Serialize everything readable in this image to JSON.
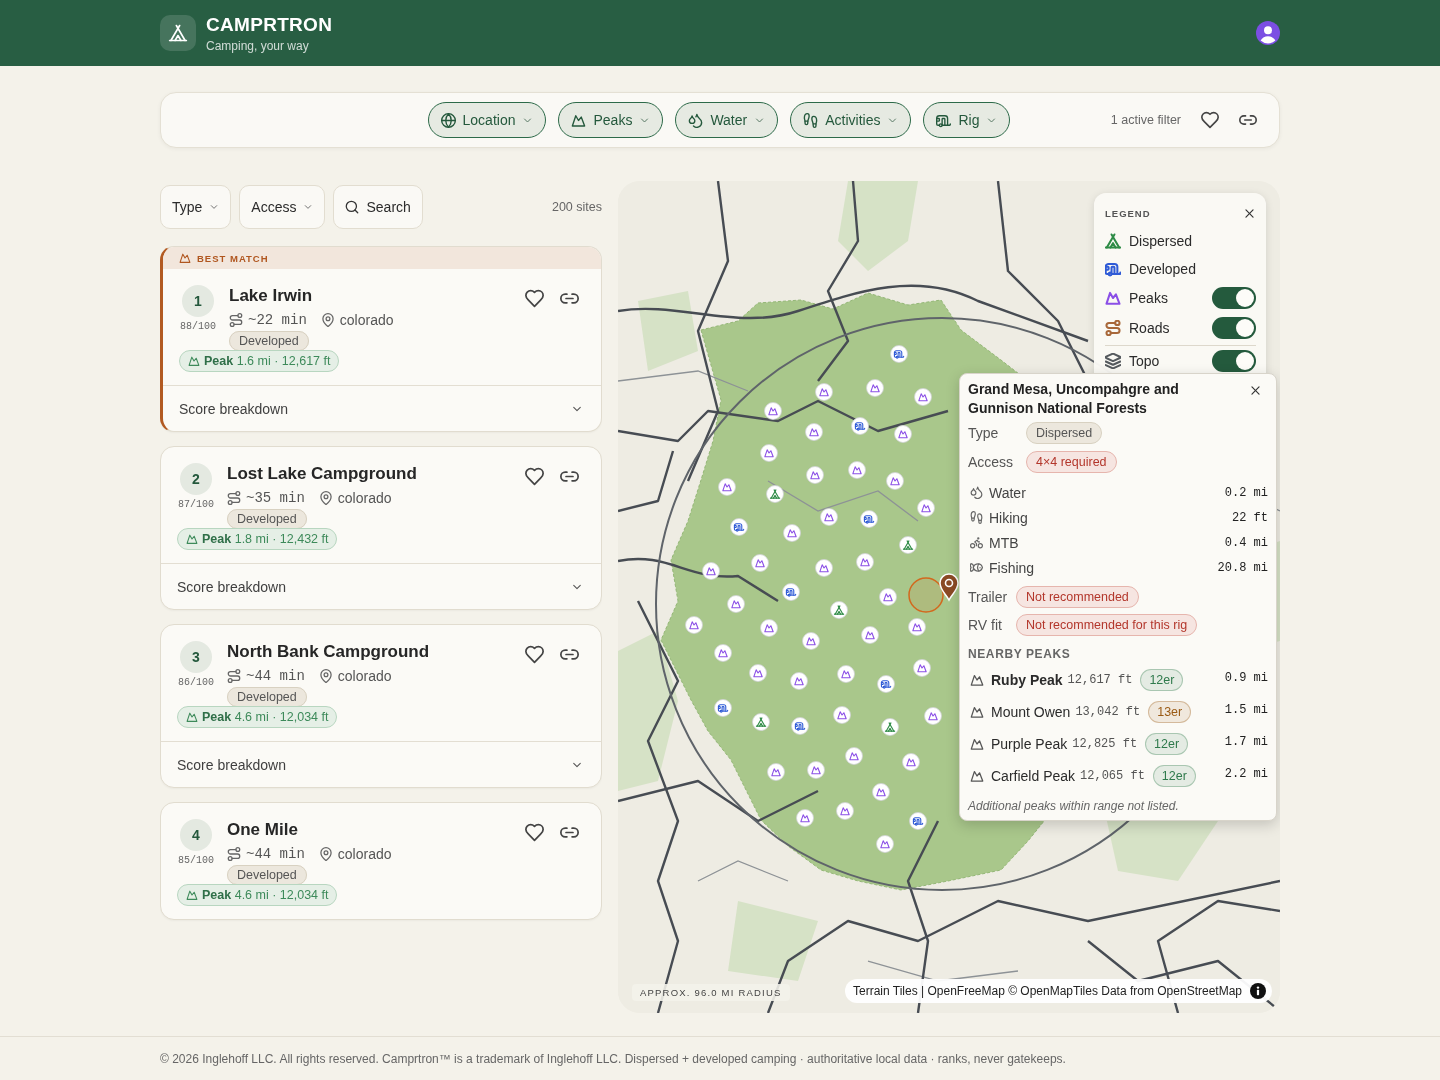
{
  "header": {
    "title": "CAMPRTRON",
    "tagline": "Camping, your way"
  },
  "filter_bar": {
    "filters": [
      {
        "label": "Location"
      },
      {
        "label": "Peaks"
      },
      {
        "label": "Water"
      },
      {
        "label": "Activities"
      },
      {
        "label": "Rig"
      }
    ],
    "active_count": "1 active filter"
  },
  "list": {
    "filters": [
      {
        "label": "Type",
        "kind": "dropdown"
      },
      {
        "label": "Access",
        "kind": "dropdown"
      },
      {
        "label": "Search",
        "kind": "search"
      }
    ],
    "count": "200 sites",
    "best_match_label": "BEST MATCH",
    "sites": [
      {
        "rank": "1",
        "score": "88/100",
        "name": "Lake Irwin",
        "drive": "~22 min",
        "region": "colorado",
        "type": "Developed",
        "peak": "**Peak** 1.6 mi · 12,617 ft",
        "breakdown": "Score breakdown",
        "best_match": true
      },
      {
        "rank": "2",
        "score": "87/100",
        "name": "Lost Lake Campground",
        "drive": "~35 min",
        "region": "colorado",
        "type": "Developed",
        "peak": "**Peak** 1.8 mi · 12,432 ft",
        "breakdown": "Score breakdown",
        "best_match": false
      },
      {
        "rank": "3",
        "score": "86/100",
        "name": "North Bank Campground",
        "drive": "~44 min",
        "region": "colorado",
        "type": "Developed",
        "peak": "**Peak** 4.6 mi · 12,034 ft",
        "breakdown": "Score breakdown",
        "best_match": false
      },
      {
        "rank": "4",
        "score": "85/100",
        "name": "One Mile",
        "drive": "~44 min",
        "region": "colorado",
        "type": "Developed",
        "peak": "**Peak** 4.6 mi · 12,034 ft",
        "best_match": false
      }
    ]
  },
  "map": {
    "legend": {
      "title": "LEGEND",
      "items": [
        {
          "label": "Dispersed",
          "kind": "key",
          "color": "#2e8b46"
        },
        {
          "label": "Developed",
          "kind": "key",
          "color": "#2f5bd6"
        },
        {
          "label": "Peaks",
          "kind": "overlay",
          "color": "#8b4fe6",
          "on": true
        },
        {
          "label": "Roads",
          "kind": "overlay",
          "color": "#a8683a",
          "on": true
        },
        {
          "label": "Topo",
          "kind": "layer",
          "color": "#555a5e",
          "on": true
        }
      ]
    },
    "popup": {
      "title": "Grand Mesa, Uncompahgre and Gunnison National Forests",
      "attributes": [
        {
          "label": "Type",
          "value": "Dispersed",
          "kind": "neutral"
        },
        {
          "label": "Access",
          "value": "4×4 required",
          "kind": "alert"
        }
      ],
      "amenities": [
        {
          "label": "Water",
          "distance": "0.2 mi"
        },
        {
          "label": "Hiking",
          "distance": "22 ft"
        },
        {
          "label": "MTB",
          "distance": "0.4 mi"
        },
        {
          "label": "Fishing",
          "distance": "20.8 mi"
        }
      ],
      "rig": [
        {
          "label": "Trailer",
          "value": "Not recommended",
          "kind": "alert"
        },
        {
          "label": "RV fit",
          "value": "Not recommended for this rig",
          "kind": "alert"
        }
      ],
      "peaks_heading": "NEARBY PEAKS",
      "peaks": [
        {
          "name": "Ruby Peak",
          "elevation": "12,617 ft",
          "class": "12er",
          "color": "#2f7a4c",
          "distance": "0.9 mi",
          "nearest": true
        },
        {
          "name": "Mount Owen",
          "elevation": "13,042 ft",
          "class": "13er",
          "color": "#9a5a14",
          "distance": "1.5 mi",
          "nearest": false
        },
        {
          "name": "Purple Peak",
          "elevation": "12,825 ft",
          "class": "12er",
          "color": "#2f7a4c",
          "distance": "1.7 mi",
          "nearest": false
        },
        {
          "name": "Carfield Peak",
          "elevation": "12,065 ft",
          "class": "12er",
          "color": "#2f7a4c",
          "distance": "2.2 mi",
          "nearest": false
        }
      ],
      "note": "Additional peaks within range not listed."
    },
    "radius_label": "APPROX. 96.0 MI RADIUS",
    "attribution": "Terrain Tiles | OpenFreeMap © OpenMapTiles Data from OpenStreetMap"
  },
  "footer": "© 2026 Inglehoff LLC. All rights reserved. Camprtron™ is a trademark of Inglehoff LLC. Dispersed + developed camping · authoritative local data · ranks, never gatekeeps."
}
